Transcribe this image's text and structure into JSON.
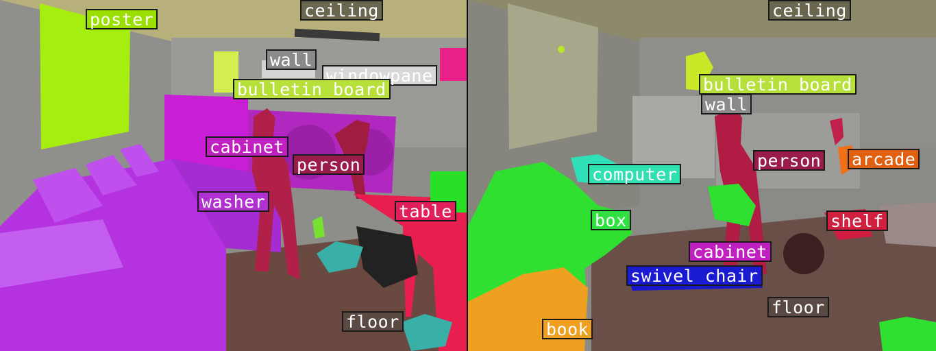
{
  "left_panel": {
    "labels": [
      {
        "id": "poster",
        "text": "poster",
        "color": "#9adf00"
      },
      {
        "id": "ceiling",
        "text": "ceiling",
        "color": "#6b6650"
      },
      {
        "id": "wall",
        "text": "wall",
        "color": "#8a8a8a"
      },
      {
        "id": "windowpane",
        "text": "windowpane",
        "color": "#d8d8d8"
      },
      {
        "id": "bulletin-board",
        "text": "bulletin board",
        "color": "#b8e03a"
      },
      {
        "id": "cabinet",
        "text": "cabinet",
        "color": "#c020c0"
      },
      {
        "id": "person",
        "text": "person",
        "color": "#9a1c4a"
      },
      {
        "id": "washer",
        "text": "washer",
        "color": "#b030d0"
      },
      {
        "id": "table",
        "text": "table",
        "color": "#e0205a"
      },
      {
        "id": "floor",
        "text": "floor",
        "color": "#5a4a44"
      }
    ]
  },
  "right_panel": {
    "labels": [
      {
        "id": "ceiling",
        "text": "ceiling",
        "color": "#6b6650"
      },
      {
        "id": "bulletin-board",
        "text": "bulletin board",
        "color": "#b8e03a"
      },
      {
        "id": "wall",
        "text": "wall",
        "color": "#8a8a8a"
      },
      {
        "id": "person",
        "text": "person",
        "color": "#9a1c4a"
      },
      {
        "id": "arcade",
        "text": "arcade",
        "color": "#e06010"
      },
      {
        "id": "computer",
        "text": "computer",
        "color": "#30e0b0"
      },
      {
        "id": "box",
        "text": "box",
        "color": "#30e040"
      },
      {
        "id": "shelf",
        "text": "shelf",
        "color": "#d02040"
      },
      {
        "id": "cabinet",
        "text": "cabinet",
        "color": "#c020c0"
      },
      {
        "id": "swivel-chair",
        "text": "swivel chair",
        "color": "#1a1ad0"
      },
      {
        "id": "floor",
        "text": "floor",
        "color": "#5a4a44"
      },
      {
        "id": "book",
        "text": "book",
        "color": "#f0a020"
      }
    ]
  }
}
